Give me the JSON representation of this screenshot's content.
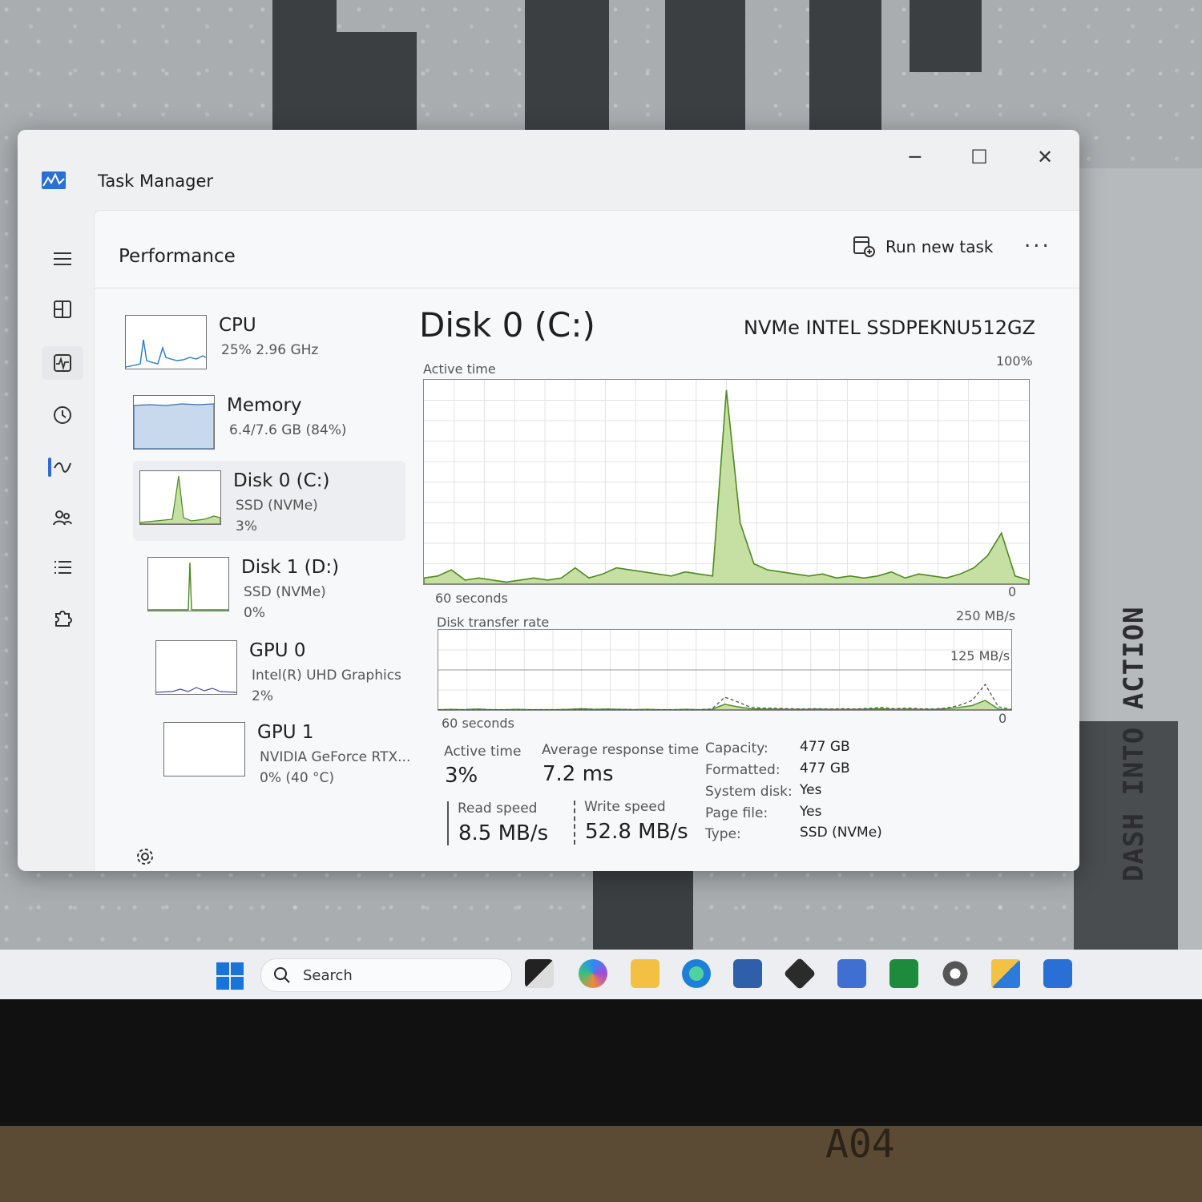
{
  "window": {
    "title": "Task Manager"
  },
  "header": {
    "section": "Performance",
    "run_new_task": "Run new task",
    "more": "..."
  },
  "devices": [
    {
      "name": "CPU",
      "sub": "25%  2.96 GHz",
      "sub2": ""
    },
    {
      "name": "Memory",
      "sub": "6.4/7.6 GB (84%)",
      "sub2": ""
    },
    {
      "name": "Disk 0 (C:)",
      "sub": "SSD (NVMe)",
      "sub2": "3%"
    },
    {
      "name": "Disk 1 (D:)",
      "sub": "SSD (NVMe)",
      "sub2": "0%"
    },
    {
      "name": "GPU 0",
      "sub": "Intel(R) UHD Graphics",
      "sub2": "2%"
    },
    {
      "name": "GPU 1",
      "sub": "NVIDIA GeForce RTX...",
      "sub2": "0% (40 °C)"
    }
  ],
  "detail": {
    "title": "Disk 0 (C:)",
    "model": "NVMe INTEL SSDPEKNU512GZ",
    "active_time_label": "Active time",
    "active_time_max": "100%",
    "time_span": "60 seconds",
    "zero": "0",
    "transfer_label": "Disk transfer rate",
    "transfer_max": "250 MB/s",
    "transfer_mid": "125 MB/s",
    "stats": {
      "active_time_label": "Active time",
      "active_time": "3%",
      "avg_response_label": "Average response time",
      "avg_response": "7.2 ms",
      "read_label": "Read speed",
      "read": "8.5 MB/s",
      "write_label": "Write speed",
      "write": "52.8 MB/s"
    },
    "props": [
      {
        "k": "Capacity:",
        "v": "477 GB"
      },
      {
        "k": "Formatted:",
        "v": "477 GB"
      },
      {
        "k": "System disk:",
        "v": "Yes"
      },
      {
        "k": "Page file:",
        "v": "Yes"
      },
      {
        "k": "Type:",
        "v": "SSD (NVMe)"
      }
    ]
  },
  "taskbar": {
    "search_placeholder": "Search"
  },
  "wallpaper": {
    "text": "DASH INTO ACTION"
  },
  "stand_text": "A04",
  "colors": {
    "graph_fill": "#c6e0a4",
    "graph_line": "#4c8a1f",
    "accent": "#2f6bd6"
  }
}
